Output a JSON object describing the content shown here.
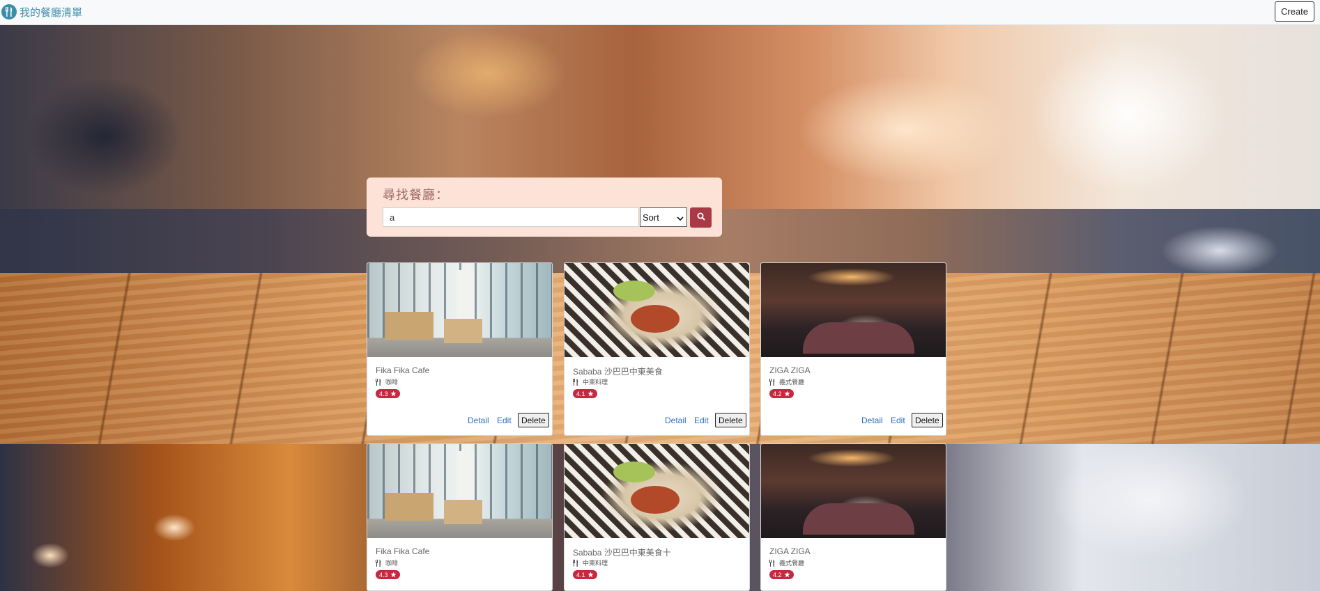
{
  "navbar": {
    "brand": "我的餐廳清單",
    "create_label": "Create"
  },
  "search": {
    "title": "尋找餐廳：",
    "value": "a",
    "sort_label": "Sort"
  },
  "cards": [
    {
      "name": "Fika Fika Cafe",
      "category": "咖啡",
      "rating": "4.3",
      "detail": "Detail",
      "edit": "Edit",
      "delete": "Delete"
    },
    {
      "name": "Sababa 沙巴巴中東美食",
      "category": "中東料理",
      "rating": "4.1",
      "detail": "Detail",
      "edit": "Edit",
      "delete": "Delete"
    },
    {
      "name": "ZIGA ZIGA",
      "category": "義式餐廳",
      "rating": "4.2",
      "detail": "Detail",
      "edit": "Edit",
      "delete": "Delete"
    },
    {
      "name": "Fika Fika Cafe",
      "category": "咖啡",
      "rating": "4.3"
    },
    {
      "name": "Sababa 沙巴巴中東美食十",
      "category": "中東料理",
      "rating": "4.1"
    },
    {
      "name": "ZIGA ZIGA",
      "category": "義式餐廳",
      "rating": "4.2"
    }
  ],
  "colors": {
    "brand": "#3e8fab",
    "panel": "#fde3d7",
    "search_button": "#a93a45",
    "rating_badge": "#c5283f",
    "link": "#2d6fc0"
  },
  "icons": {
    "brand": "utensils-icon",
    "search": "search-icon",
    "category": "utensils-icon",
    "rating": "star-icon"
  }
}
